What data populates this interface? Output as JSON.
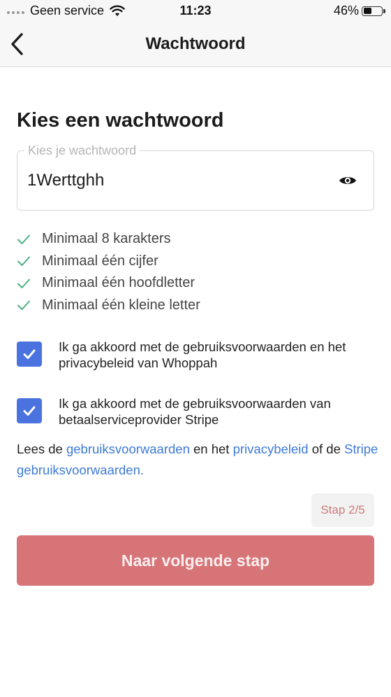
{
  "status_bar": {
    "carrier": "Geen service",
    "time": "11:23",
    "battery_percent": "46%",
    "battery_level": 0.46,
    "icons": [
      "signal-dots-icon",
      "wifi-icon",
      "battery-icon"
    ]
  },
  "nav": {
    "title": "Wachtwoord",
    "back_icon": "chevron-left-icon"
  },
  "main": {
    "title": "Kies een wachtwoord",
    "password": {
      "label": "Kies je wachtwoord",
      "value": "1Werttghh",
      "toggle_icon": "eye-icon"
    },
    "requirements": [
      {
        "label": "Minimaal 8 karakters",
        "met": true
      },
      {
        "label": "Minimaal één cijfer",
        "met": true
      },
      {
        "label": "Minimaal één hoofdletter",
        "met": true
      },
      {
        "label": "Minimaal één kleine letter",
        "met": true
      }
    ],
    "agreements": [
      {
        "label": "Ik ga akkoord met de gebruiksvoorwaarden en het privacybeleid van Whoppah",
        "checked": true
      },
      {
        "label": "Ik ga akkoord met de gebruiksvoorwaarden van betaalserviceprovider Stripe",
        "checked": true
      }
    ],
    "terms": {
      "prefix": "Lees de ",
      "link_terms": "gebruiksvoorwaarden",
      "middle": " en het ",
      "link_privacy": "privacybeleid",
      "suffix": " of de ",
      "link_stripe": "Stripe gebruiksvoorwaarden."
    },
    "step": "Stap 2/5",
    "next_button": "Naar volgende stap"
  },
  "colors": {
    "accent_blue": "#4a73df",
    "link_blue": "#3d7ad6",
    "check_green": "#4caf82",
    "button_red": "#d67478"
  }
}
